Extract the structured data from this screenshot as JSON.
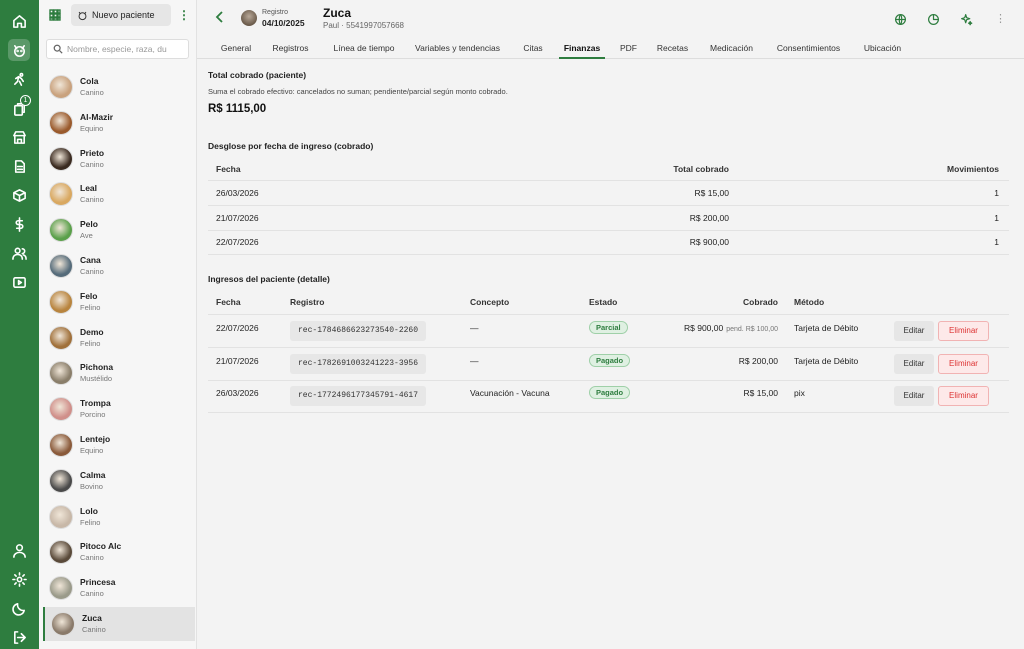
{
  "rail": {
    "icons": [
      "home-icon",
      "pet-icon",
      "run-icon",
      "documents-icon",
      "store-icon",
      "file-icon",
      "box-icon",
      "dollar-icon",
      "users-icon",
      "video-icon",
      "user-icon",
      "settings-icon",
      "moon-icon",
      "logout-icon"
    ],
    "badge": "1",
    "accent": "#2e7d3f"
  },
  "patient_list": {
    "new_label": "Nuevo paciente",
    "search_placeholder": "Nombre, especie, raza, du",
    "items": [
      {
        "name": "Cola",
        "species": "Canino",
        "color": "#c9a27e"
      },
      {
        "name": "Al-Mazir",
        "species": "Equino",
        "color": "#9a5a2c"
      },
      {
        "name": "Prieto",
        "species": "Canino",
        "color": "#3a2a20"
      },
      {
        "name": "Leal",
        "species": "Canino",
        "color": "#d9a860"
      },
      {
        "name": "Pelo",
        "species": "Ave",
        "color": "#5aa04a"
      },
      {
        "name": "Cana",
        "species": "Canino",
        "color": "#556b7a"
      },
      {
        "name": "Felo",
        "species": "Felino",
        "color": "#b8843e"
      },
      {
        "name": "Demo",
        "species": "Felino",
        "color": "#a0703a"
      },
      {
        "name": "Pichona",
        "species": "Mustélido",
        "color": "#8a7e6a"
      },
      {
        "name": "Trompa",
        "species": "Porcino",
        "color": "#d08f8a"
      },
      {
        "name": "Lentejo",
        "species": "Equino",
        "color": "#8a5a3a"
      },
      {
        "name": "Calma",
        "species": "Bovino",
        "color": "#4a4a4a"
      },
      {
        "name": "Lolo",
        "species": "Felino",
        "color": "#c8b8a8"
      },
      {
        "name": "Pitoco Alc",
        "species": "Canino",
        "color": "#5a4a3a"
      },
      {
        "name": "Princesa",
        "species": "Canino",
        "color": "#9a9a8a"
      },
      {
        "name": "Zuca",
        "species": "Canino",
        "color": "#8a7a6a"
      }
    ]
  },
  "header": {
    "registro_label": "Registro",
    "registro_date": "04/10/2025",
    "patient_name": "Zuca",
    "owner": "Paul · 5541997057668"
  },
  "tabs": [
    "General",
    "Registros",
    "Línea de tiempo",
    "Variables y tendencias",
    "Citas",
    "Finanzas",
    "PDF",
    "Recetas",
    "Medicación",
    "Consentimientos",
    "Ubicación"
  ],
  "active_tab": "Finanzas",
  "summary": {
    "title": "Total cobrado (paciente)",
    "note": "Suma el cobrado efectivo: cancelados no suman; pendiente/parcial según monto cobrado.",
    "total": "R$ 1115,00"
  },
  "breakdown": {
    "title": "Desglose por fecha de ingreso (cobrado)",
    "headers": {
      "fecha": "Fecha",
      "total": "Total cobrado",
      "movimientos": "Movimientos"
    },
    "rows": [
      {
        "fecha": "26/03/2026",
        "total": "R$ 15,00",
        "movimientos": "1"
      },
      {
        "fecha": "21/07/2026",
        "total": "R$ 200,00",
        "movimientos": "1"
      },
      {
        "fecha": "22/07/2026",
        "total": "R$ 900,00",
        "movimientos": "1"
      }
    ]
  },
  "detail": {
    "title": "Ingresos del paciente (detalle)",
    "headers": {
      "fecha": "Fecha",
      "registro": "Registro",
      "concepto": "Concepto",
      "estado": "Estado",
      "cobrado": "Cobrado",
      "metodo": "Método"
    },
    "edit_label": "Editar",
    "delete_label": "Eliminar",
    "rows": [
      {
        "fecha": "22/07/2026",
        "registro": "rec-1784686623273540-2260",
        "concepto": "—",
        "estado": "Parcial",
        "cobrado": "R$ 900,00",
        "pendiente": "pend. R$ 100,00",
        "metodo": "Tarjeta de Débito"
      },
      {
        "fecha": "21/07/2026",
        "registro": "rec-1782691003241223-3956",
        "concepto": "—",
        "estado": "Pagado",
        "cobrado": "R$ 200,00",
        "pendiente": "",
        "metodo": "Tarjeta de Débito"
      },
      {
        "fecha": "26/03/2026",
        "registro": "rec-1772496177345791-4617",
        "concepto": "Vacunación - Vacuna",
        "estado": "Pagado",
        "cobrado": "R$ 15,00",
        "pendiente": "",
        "metodo": "pix"
      }
    ]
  }
}
